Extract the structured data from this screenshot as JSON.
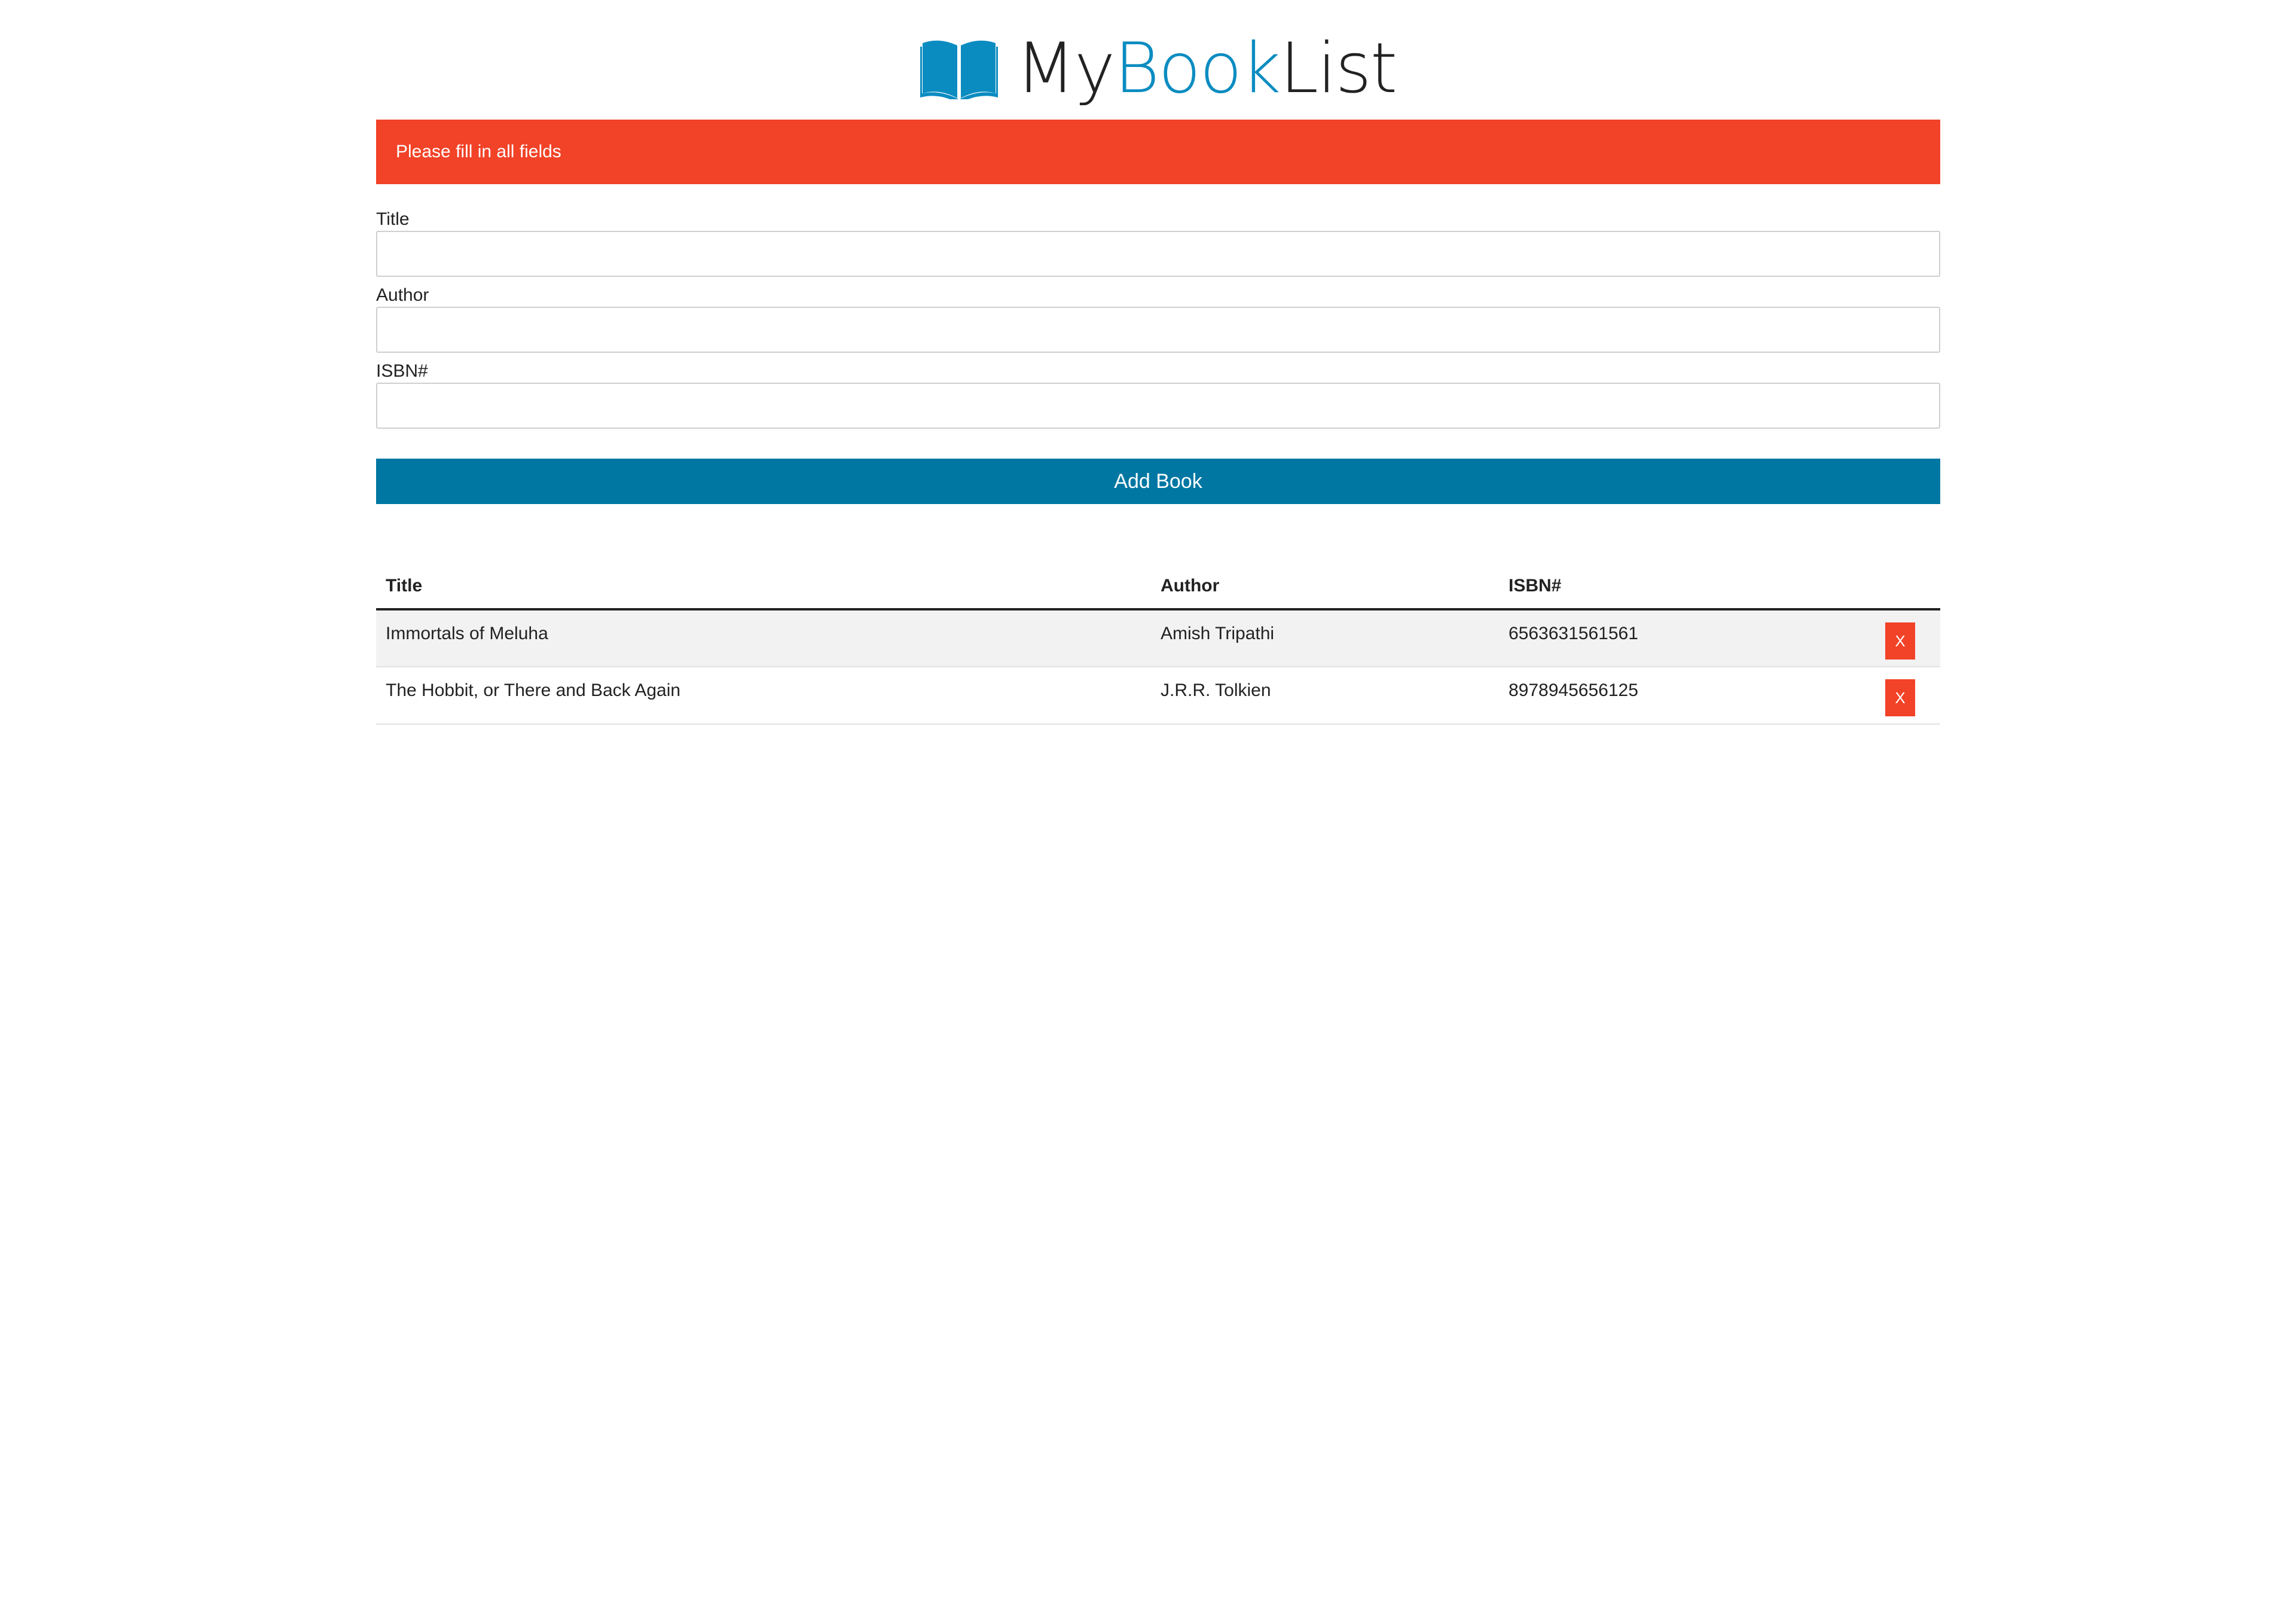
{
  "brand": {
    "part1": "My",
    "part2": "Book",
    "part3": "List",
    "accent_color": "#0b8cc1",
    "icon": "open-book-icon"
  },
  "alert": {
    "message": "Please fill in all fields",
    "color": "#f24227"
  },
  "form": {
    "title_label": "Title",
    "title_value": "",
    "author_label": "Author",
    "author_value": "",
    "isbn_label": "ISBN#",
    "isbn_value": "",
    "submit_label": "Add Book",
    "submit_color": "#0077a3"
  },
  "table": {
    "headers": [
      "Title",
      "Author",
      "ISBN#",
      ""
    ],
    "rows": [
      {
        "title": "Immortals of Meluha",
        "author": "Amish Tripathi",
        "isbn": "6563631561561",
        "delete_label": "X"
      },
      {
        "title": "The Hobbit, or There and Back Again",
        "author": "J.R.R. Tolkien",
        "isbn": "8978945656125",
        "delete_label": "X"
      }
    ]
  }
}
